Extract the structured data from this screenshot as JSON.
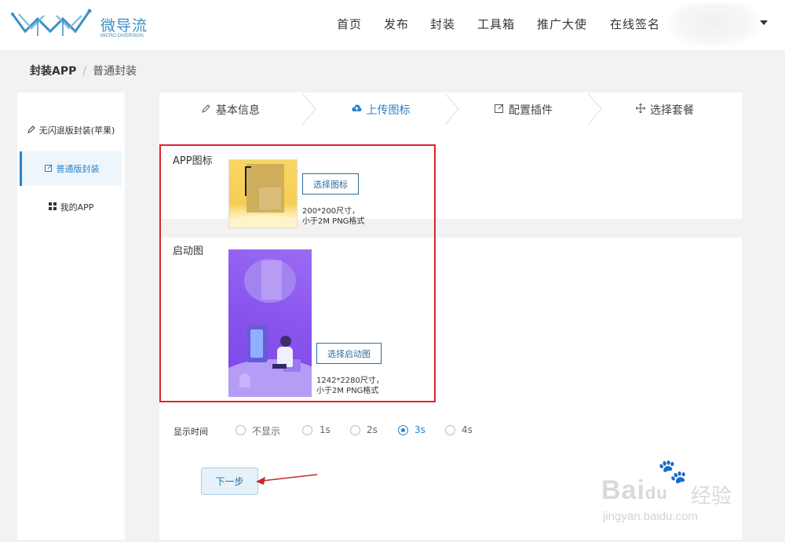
{
  "brand": {
    "name_cn": "微导流",
    "name_en": "MICRO DIVERSION",
    "color": "#3d8fc7"
  },
  "nav": {
    "items": [
      "首页",
      "发布",
      "封装",
      "工具箱",
      "推广大使",
      "在线签名"
    ],
    "user_menu_caret": "caret-down-icon"
  },
  "breadcrumb": {
    "root": "封装APP",
    "separator": "/",
    "current": "普通封装"
  },
  "sidebar": {
    "items": [
      {
        "label": "无闪退版封装(苹果)",
        "icon": "edit-icon",
        "active": false
      },
      {
        "label": "普通版封装",
        "icon": "edit-square-icon",
        "active": true
      },
      {
        "label": "我的APP",
        "icon": "grid-icon",
        "active": false
      }
    ]
  },
  "steps": [
    {
      "label": "基本信息",
      "icon": "pen-icon",
      "active": false
    },
    {
      "label": "上传图标",
      "icon": "cloud-upload-icon",
      "active": true
    },
    {
      "label": "配置插件",
      "icon": "edit-square-icon",
      "active": false
    },
    {
      "label": "选择套餐",
      "icon": "move-icon",
      "active": false
    }
  ],
  "upload": {
    "app_icon_label": "APP图标",
    "choose_icon_button": "选择图标",
    "icon_hint_line1": "200*200尺寸，",
    "icon_hint_line2": "小于2M PNG格式",
    "launch_label": "启动图",
    "choose_launch_button": "选择启动图",
    "launch_hint_line1": "1242*2280尺寸，",
    "launch_hint_line2": "小于2M PNG格式"
  },
  "display_time": {
    "label": "显示时间",
    "options": [
      "不显示",
      "1s",
      "2s",
      "3s",
      "4s"
    ],
    "selected": "3s"
  },
  "next_button": "下一步",
  "watermark": {
    "text": "Bai",
    "text2": "du",
    "cn": "经验",
    "url": "jingyan.baidu.com"
  },
  "colors": {
    "accent": "#2b82c8",
    "highlight_border": "#d9262a",
    "button_text": "#2b6f9a"
  }
}
